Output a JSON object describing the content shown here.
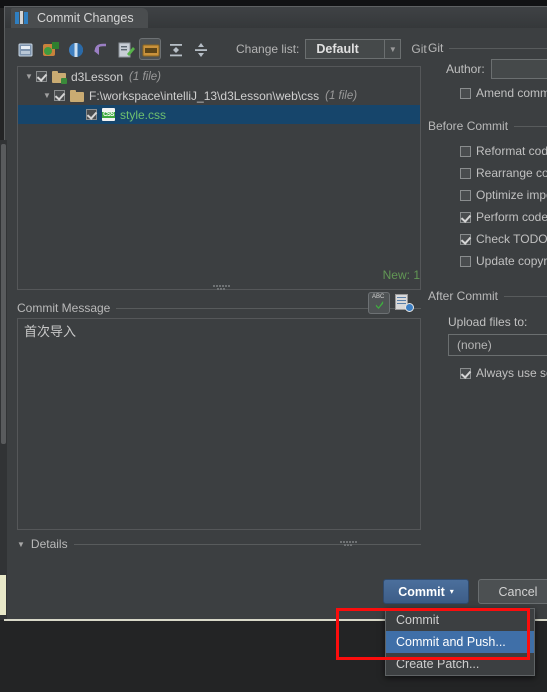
{
  "window": {
    "title": "Commit Changes",
    "logo_icon": "intellij-idea-logo-icon"
  },
  "toolbar": {
    "icons": [
      {
        "name": "show-diff-icon",
        "active": false
      },
      {
        "name": "refresh-changes-icon",
        "active": false
      },
      {
        "name": "rollback-revert-icon",
        "active": false
      },
      {
        "name": "undo-arrow-icon",
        "active": false
      },
      {
        "name": "edit-source-icon",
        "active": false
      },
      {
        "name": "group-by-directory-icon",
        "active": true
      },
      {
        "name": "expand-all-icon",
        "active": false
      },
      {
        "name": "collapse-all-icon",
        "active": false
      }
    ],
    "change_list_label": "Change list:",
    "change_list_value": "Default",
    "vcs_label": "Git"
  },
  "file_tree": {
    "rows": [
      {
        "label": "d3Lesson",
        "count": "(1 file)",
        "icon": "folder-icon",
        "checked": true,
        "expanded": true,
        "selected": false,
        "indent": 0
      },
      {
        "label": "F:\\workspace\\intelliJ_13\\d3Lesson\\web\\css",
        "count": "(1 file)",
        "icon": "folder-icon",
        "checked": true,
        "expanded": true,
        "selected": false,
        "indent": 1
      },
      {
        "label": "style.css",
        "count": "",
        "icon": "css-file-icon",
        "checked": true,
        "expanded": null,
        "selected": true,
        "indent": 2
      }
    ],
    "new_count_label": "New: 1",
    "new_count_color": "#629755"
  },
  "commit_message": {
    "section_label": "Commit Message",
    "value": "首次导入",
    "placeholder": "",
    "spellcheck_icon": "abc-spellcheck-icon",
    "history_icon": "commit-message-history-icon"
  },
  "details": {
    "label": "Details",
    "expanded": true
  },
  "options": {
    "git_group": {
      "title": "Git",
      "author_label": "Author:",
      "author_value": "",
      "amend_label": "Amend commit",
      "amend_checked": false
    },
    "before_commit_group": {
      "title": "Before Commit",
      "items": [
        {
          "label": "Reformat code",
          "checked": false
        },
        {
          "label": "Rearrange code",
          "checked": false
        },
        {
          "label": "Optimize imports",
          "checked": false
        },
        {
          "label": "Perform code analysis",
          "checked": true
        },
        {
          "label": "Check TODO (Show All)",
          "checked": true
        },
        {
          "label": "Update copyright",
          "checked": false
        }
      ]
    },
    "after_commit_group": {
      "title": "After Commit",
      "upload_label": "Upload files to:",
      "upload_value": "(none)",
      "always_use_label": "Always use selected server",
      "always_use_checked": true
    }
  },
  "footer": {
    "commit_label": "Commit",
    "commit_caret": "▾",
    "cancel_label": "Cancel"
  },
  "popup_menu": {
    "items": [
      {
        "label": "Commit",
        "highlighted": false
      },
      {
        "label": "Commit and Push...",
        "highlighted": true
      },
      {
        "label": "Create Patch...",
        "highlighted": false
      }
    ]
  },
  "annotation": {
    "type": "red-rectangle-highlight",
    "color": "#fb0d0d"
  }
}
